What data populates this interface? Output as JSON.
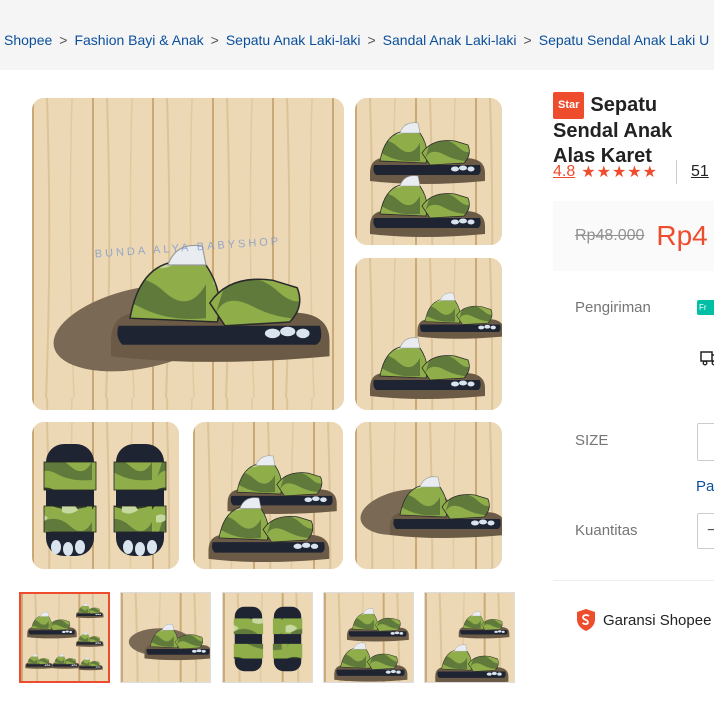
{
  "breadcrumb": {
    "items": [
      "Shopee",
      "Fashion Bayi & Anak",
      "Sepatu Anak Laki-laki",
      "Sandal Anak Laki-laki",
      "Sepatu Sendal Anak Laki U"
    ],
    "separator": ">"
  },
  "gallery": {
    "watermark": "BUNDA ALYA BABYSHOP",
    "thumbnails_count": 5,
    "active_thumbnail": 1
  },
  "product": {
    "badge": "Star",
    "title": "Sepatu Sendal Anak Alas Karet",
    "rating": "4.8",
    "stars": "★★★★★",
    "sold_partial": "51"
  },
  "price": {
    "original": "Rp48.000",
    "current": "Rp4"
  },
  "shipping": {
    "label": "Pengiriman",
    "free_badge": "Fr"
  },
  "size": {
    "label": "SIZE",
    "guide_link": "Pa"
  },
  "quantity": {
    "label": "Kuantitas",
    "minus": "−"
  },
  "guarantee": {
    "label": "Garansi Shopee"
  },
  "colors": {
    "accent": "#ee4d2d",
    "link": "#0b4f9c",
    "camo_light": "#8fae4a",
    "camo_dark": "#2f3e2a",
    "sole": "#6b5a45"
  }
}
